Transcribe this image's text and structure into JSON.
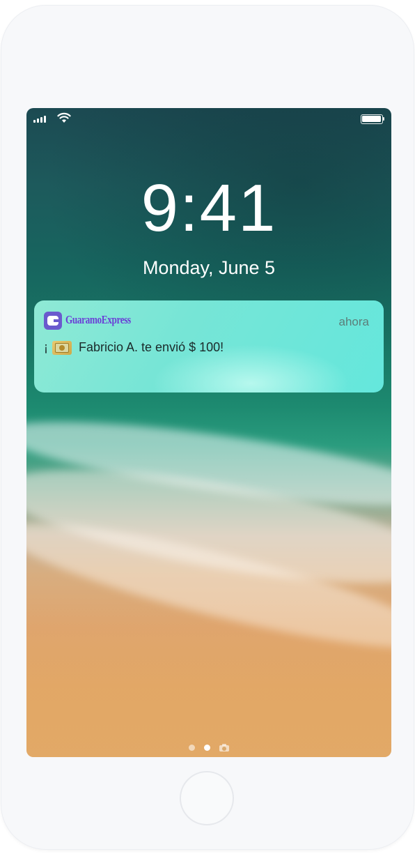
{
  "lock_screen": {
    "time": "9:41",
    "date": "Monday, June 5"
  },
  "status_bar": {
    "signal_icon": "cellular-signal-icon",
    "wifi_icon": "wifi-icon",
    "battery_icon": "battery-icon",
    "battery_level": 1.0
  },
  "notification": {
    "app_icon": "guaramo-express-app-icon",
    "app_name": "GuaramoExpress",
    "time_ago": "ahora",
    "message_prefix": "¡",
    "message_icon": "money-bills-icon",
    "message_text": "Fabricio A. te envió $ 100!",
    "accent_color": "#6a3fd6"
  },
  "page_indicator": {
    "pages": 2,
    "active_index": 1,
    "camera_icon": "camera-icon"
  },
  "device": {
    "home_button": "home-button"
  }
}
